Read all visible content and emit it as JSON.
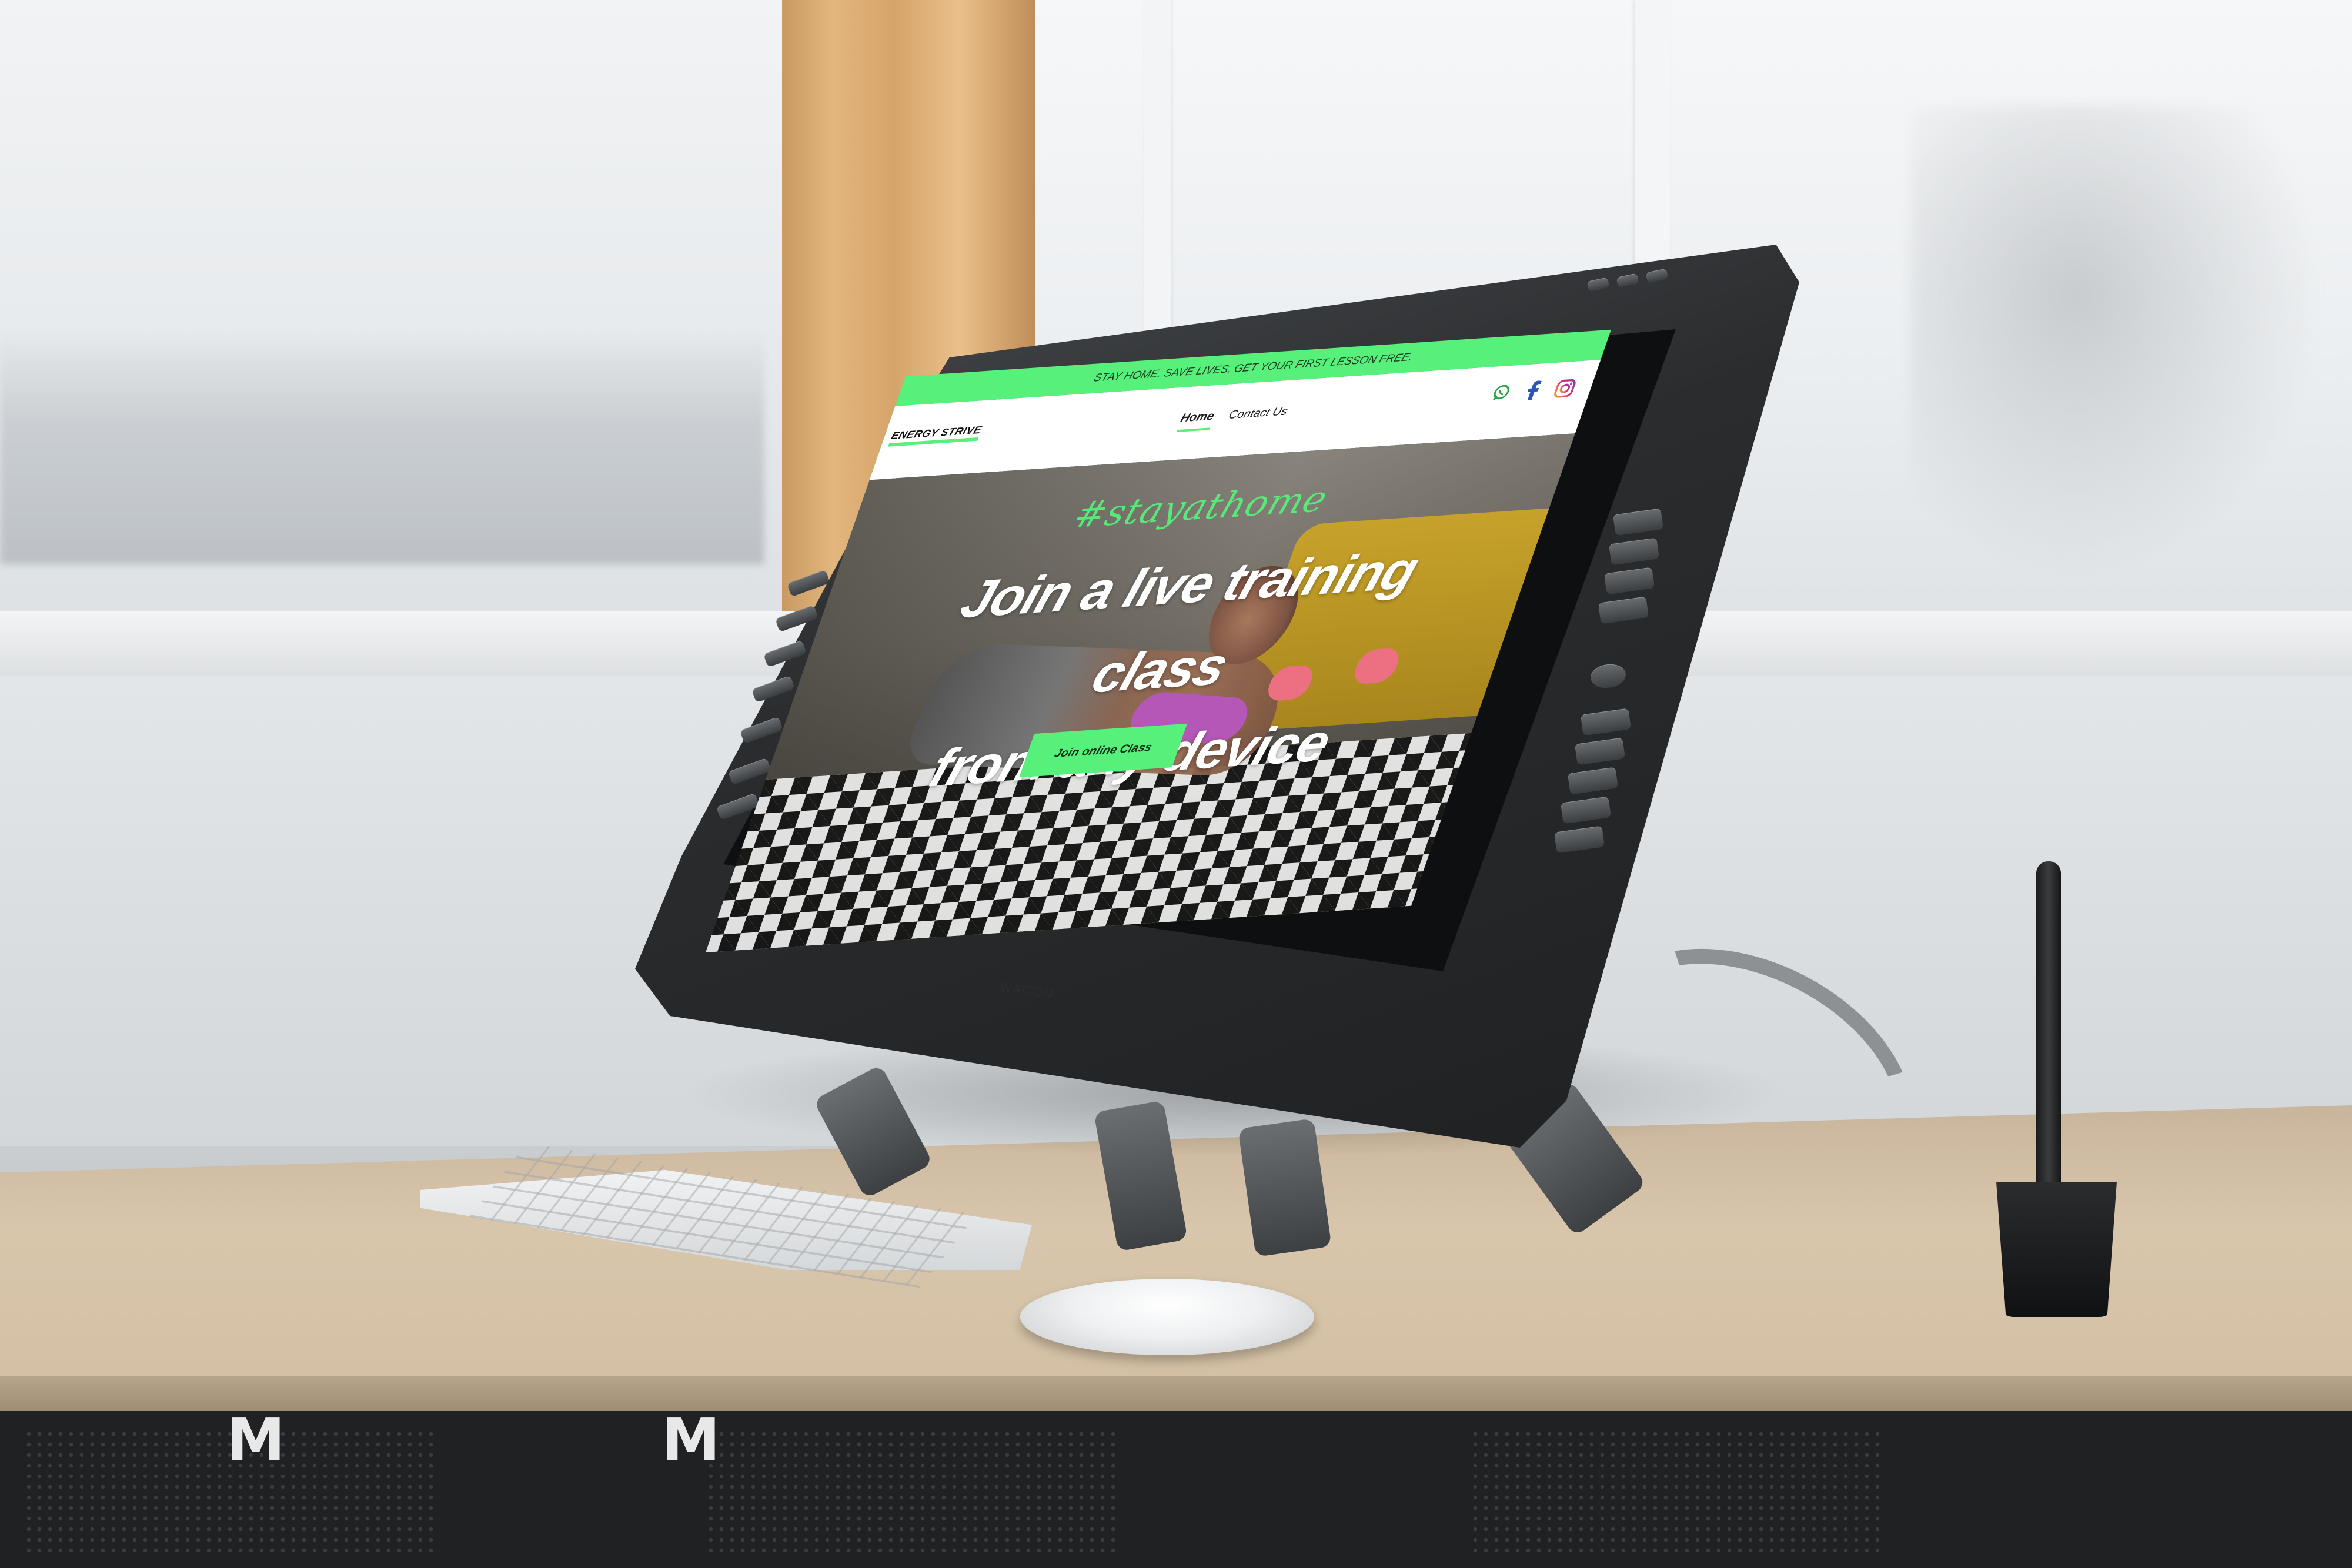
{
  "announcement": "STAY HOME. SAVE LIVES. GET YOUR FIRST LESSON FREE.",
  "site": {
    "logo": "ENERGY STRIVE",
    "nav": [
      {
        "label": "Home",
        "active": true
      },
      {
        "label": "Contact Us",
        "active": false
      }
    ],
    "socials": [
      "whatsapp-icon",
      "facebook-icon",
      "instagram-icon"
    ]
  },
  "hero": {
    "hashtag": "#stayathome",
    "headline_line1": "Join a live training class",
    "headline_line2": "from any device",
    "cta_label": "Join online Class"
  },
  "device": {
    "brand": "WACOM"
  },
  "colors": {
    "accent": "#56f07a",
    "dark": "#1b1b1b",
    "white": "#ffffff"
  }
}
